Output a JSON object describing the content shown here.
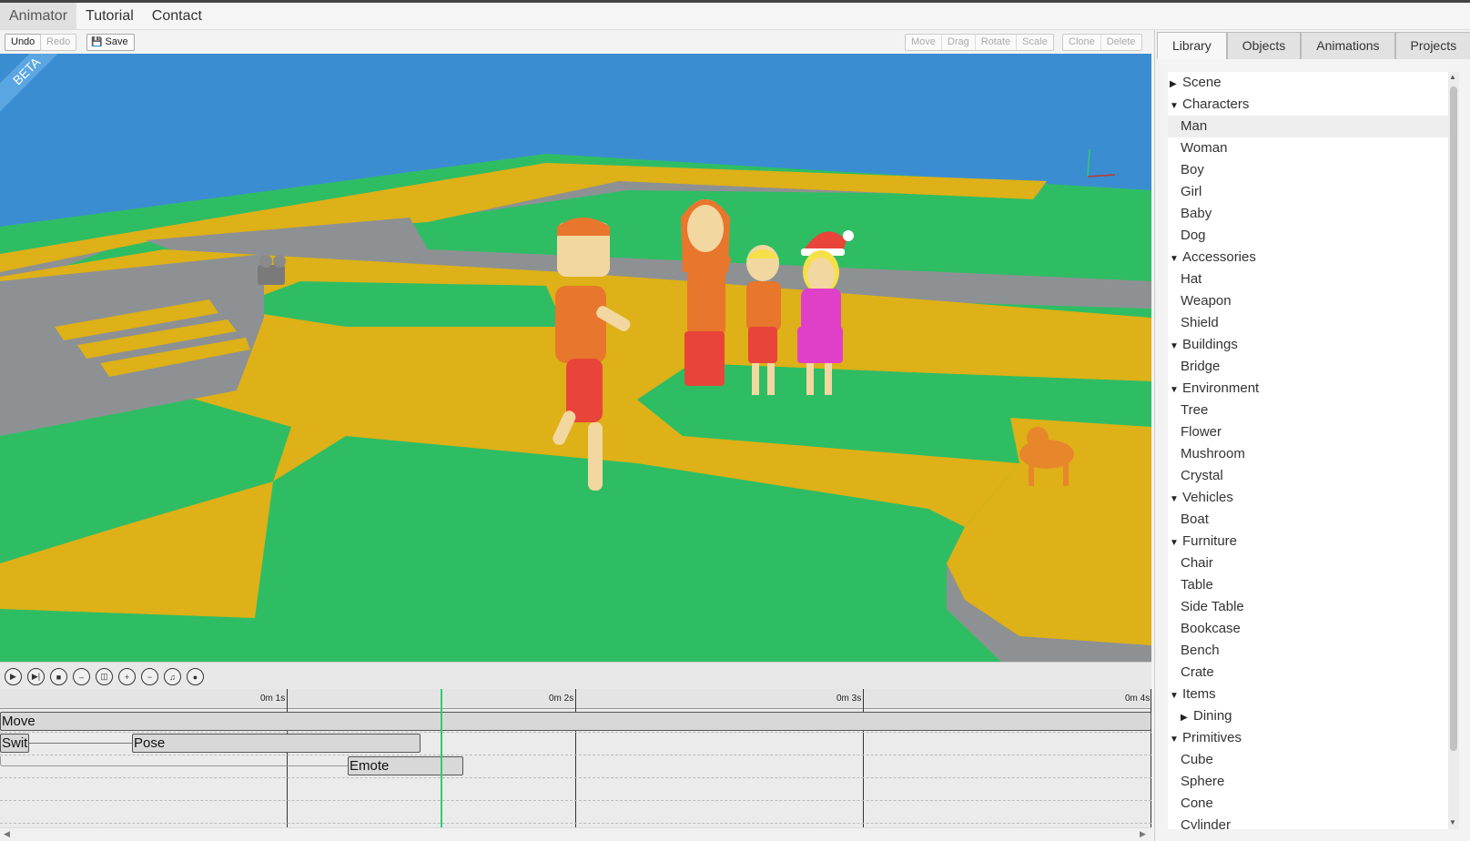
{
  "menu": {
    "brand": "Animator",
    "items": [
      "Tutorial",
      "Contact"
    ]
  },
  "toolbar": {
    "undo": "Undo",
    "redo": "Redo",
    "save": "Save",
    "transform": [
      "Move",
      "Drag",
      "Rotate",
      "Scale"
    ],
    "edit": [
      "Clone",
      "Delete"
    ]
  },
  "viewport": {
    "badge": "BETA"
  },
  "playback": [
    "play-icon",
    "step-icon",
    "stop-icon",
    "remove-icon",
    "trash-icon",
    "zoom-in-icon",
    "zoom-out-icon",
    "music-icon",
    "camera-icon"
  ],
  "timeline": {
    "ticks": [
      "0m 1s",
      "0m 2s",
      "0m 3s",
      "0m 4s"
    ],
    "clips": {
      "move": "Move",
      "switch": "Swit",
      "pose": "Pose",
      "emote": "Emote"
    }
  },
  "sidebar": {
    "tabs": [
      "Library",
      "Objects",
      "Animations",
      "Projects"
    ],
    "active_tab": "Library",
    "tree": [
      {
        "label": "Scene",
        "type": "cat",
        "expanded": false
      },
      {
        "label": "Characters",
        "type": "cat",
        "expanded": true
      },
      {
        "label": "Man",
        "type": "leaf",
        "selected": true
      },
      {
        "label": "Woman",
        "type": "leaf"
      },
      {
        "label": "Boy",
        "type": "leaf"
      },
      {
        "label": "Girl",
        "type": "leaf"
      },
      {
        "label": "Baby",
        "type": "leaf"
      },
      {
        "label": "Dog",
        "type": "leaf"
      },
      {
        "label": "Accessories",
        "type": "cat",
        "expanded": true
      },
      {
        "label": "Hat",
        "type": "leaf"
      },
      {
        "label": "Weapon",
        "type": "leaf"
      },
      {
        "label": "Shield",
        "type": "leaf"
      },
      {
        "label": "Buildings",
        "type": "cat",
        "expanded": true
      },
      {
        "label": "Bridge",
        "type": "leaf"
      },
      {
        "label": "Environment",
        "type": "cat",
        "expanded": true
      },
      {
        "label": "Tree",
        "type": "leaf"
      },
      {
        "label": "Flower",
        "type": "leaf"
      },
      {
        "label": "Mushroom",
        "type": "leaf"
      },
      {
        "label": "Crystal",
        "type": "leaf"
      },
      {
        "label": "Vehicles",
        "type": "cat",
        "expanded": true
      },
      {
        "label": "Boat",
        "type": "leaf"
      },
      {
        "label": "Furniture",
        "type": "cat",
        "expanded": true
      },
      {
        "label": "Chair",
        "type": "leaf"
      },
      {
        "label": "Table",
        "type": "leaf"
      },
      {
        "label": "Side Table",
        "type": "leaf"
      },
      {
        "label": "Bookcase",
        "type": "leaf"
      },
      {
        "label": "Bench",
        "type": "leaf"
      },
      {
        "label": "Crate",
        "type": "leaf"
      },
      {
        "label": "Items",
        "type": "cat",
        "expanded": true
      },
      {
        "label": "Dining",
        "type": "sub",
        "expanded": false
      },
      {
        "label": "Primitives",
        "type": "cat",
        "expanded": true
      },
      {
        "label": "Cube",
        "type": "leaf"
      },
      {
        "label": "Sphere",
        "type": "leaf"
      },
      {
        "label": "Cone",
        "type": "leaf"
      },
      {
        "label": "Cylinder",
        "type": "leaf"
      }
    ]
  },
  "colors": {
    "sky": "#3b8dd1",
    "grass": "#2fbd64",
    "path": "#ddb117",
    "stone": "#8e9193",
    "playhead": "#2ecc71"
  }
}
